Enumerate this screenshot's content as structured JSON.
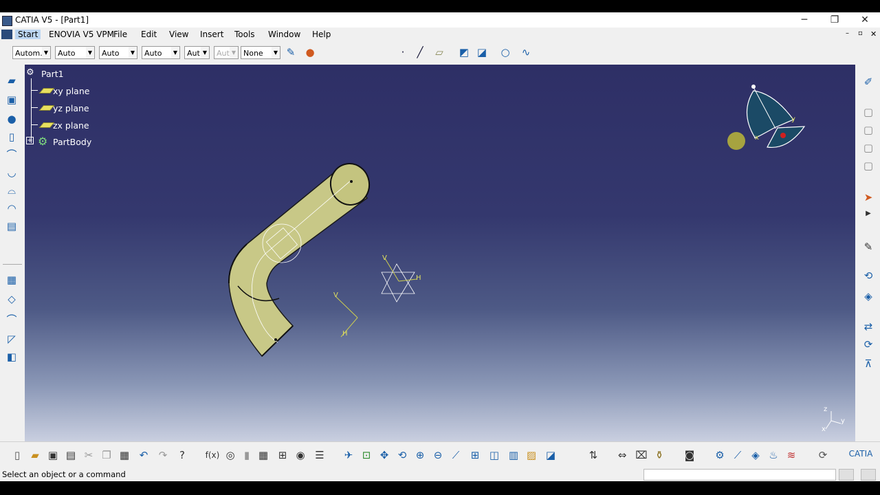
{
  "window": {
    "title": "CATIA V5 - [Part1]",
    "controls": {
      "minimize": "─",
      "restore": "❐",
      "close": "✕"
    }
  },
  "menubar": {
    "items": [
      "Start",
      "ENOVIA V5 VPM",
      "File",
      "Edit",
      "View",
      "Insert",
      "Tools",
      "Window",
      "Help"
    ]
  },
  "toolbar": {
    "combos": [
      "Autom.",
      "Auto",
      "Auto",
      "Auto",
      "Aut",
      "Aut",
      "None"
    ]
  },
  "tree": {
    "root": "Part1",
    "items": [
      "xy plane",
      "yz plane",
      "zx plane",
      "PartBody"
    ]
  },
  "compass": {
    "x": "x",
    "y": "y",
    "z": "z"
  },
  "sketch_labels": {
    "v1": "V",
    "h1": "H",
    "v2": "V",
    "h2": "H"
  },
  "status": {
    "message": "Select an object or a command"
  },
  "colors": {
    "part": "#c8c887",
    "tree_text": "#ffffff",
    "viewport_top": "#2e2f66"
  }
}
